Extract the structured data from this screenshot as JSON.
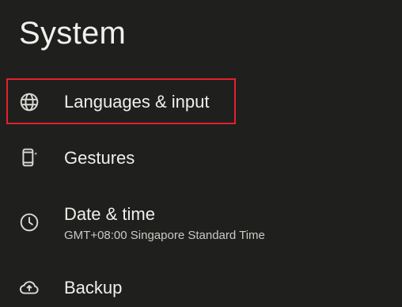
{
  "page": {
    "title": "System"
  },
  "items": [
    {
      "label": "Languages & input",
      "icon": "globe-icon"
    },
    {
      "label": "Gestures",
      "icon": "phone-gesture-icon"
    },
    {
      "label": "Date & time",
      "summary": "GMT+08:00 Singapore Standard Time",
      "icon": "clock-icon"
    },
    {
      "label": "Backup",
      "icon": "cloud-upload-icon"
    }
  ],
  "colors": {
    "background": "#1f201d",
    "text": "#efefec",
    "highlight": "#e3202c"
  }
}
